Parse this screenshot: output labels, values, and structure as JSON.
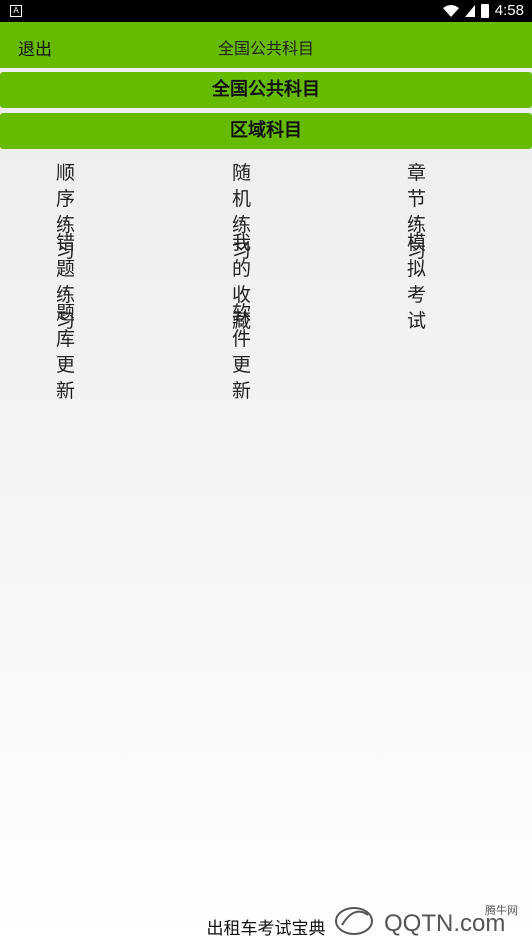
{
  "status_bar": {
    "time": "4:58",
    "left_icon": "notification-A"
  },
  "topbar": {
    "back_label": "退出",
    "title": "全国公共科目"
  },
  "sections": [
    {
      "label": "全国公共科目"
    },
    {
      "label": "区域科目"
    }
  ],
  "menu": [
    {
      "line1": "顺序",
      "line2": "练习"
    },
    {
      "line1": "随机",
      "line2": "练习"
    },
    {
      "line1": "章节",
      "line2": "练习"
    },
    {
      "line1": "错题",
      "line2": "练习"
    },
    {
      "line1": "我的",
      "line2": "收藏"
    },
    {
      "line1": "模拟",
      "line2": "考试"
    },
    {
      "line1": "题库",
      "line2": "更新"
    },
    {
      "line1": "软件",
      "line2": "更新"
    }
  ],
  "footer": {
    "text": "出租车考试宝典"
  },
  "watermark": {
    "text": "腾牛网",
    "brand": "QQTN.com"
  },
  "colors": {
    "accent": "#66bb00",
    "statusbar": "#000000"
  }
}
